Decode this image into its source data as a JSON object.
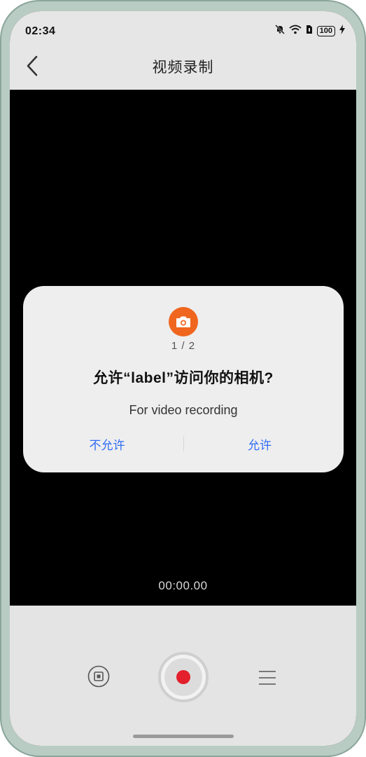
{
  "status_bar": {
    "time": "02:34",
    "battery": "100"
  },
  "header": {
    "title": "视频录制",
    "back_icon": "chevron-left-icon"
  },
  "dialog": {
    "icon": "camera-icon",
    "step": "1 / 2",
    "question": "允许“label”访问你的相机?",
    "reason": "For video recording",
    "deny_label": "不允许",
    "allow_label": "允许",
    "accent_color": "#2f6cf5",
    "icon_color": "#f0661e"
  },
  "recorder": {
    "timer": "00:00.00",
    "record_color": "#e3202b",
    "gallery_icon": "gallery-icon",
    "menu_icon": "menu-icon"
  }
}
